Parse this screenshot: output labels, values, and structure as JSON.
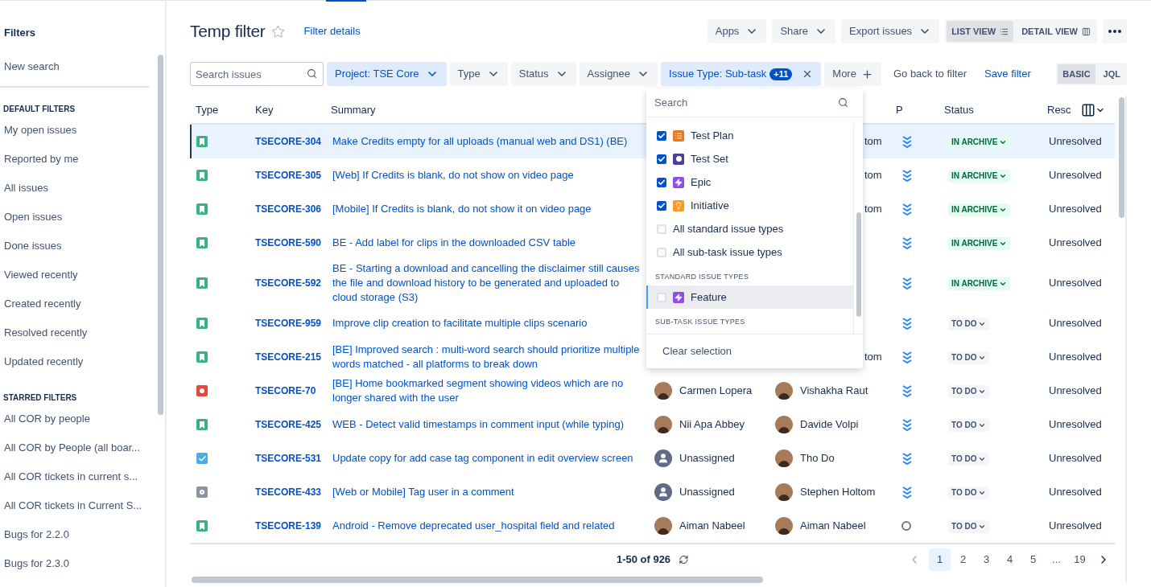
{
  "sidebar": {
    "title": "Filters",
    "top_items": [
      {
        "label": "New search"
      }
    ],
    "sections": [
      {
        "heading": "DEFAULT FILTERS",
        "items": [
          {
            "label": "My open issues"
          },
          {
            "label": "Reported by me"
          },
          {
            "label": "All issues"
          },
          {
            "label": "Open issues"
          },
          {
            "label": "Done issues"
          },
          {
            "label": "Viewed recently"
          },
          {
            "label": "Created recently"
          },
          {
            "label": "Resolved recently"
          },
          {
            "label": "Updated recently"
          }
        ]
      },
      {
        "heading": "STARRED FILTERS",
        "items": [
          {
            "label": "All COR by people"
          },
          {
            "label": "All COR by People (all boar..."
          },
          {
            "label": "All COR tickets in current s..."
          },
          {
            "label": "All COR tickets in Current S..."
          },
          {
            "label": "Bugs for 2.2.0"
          },
          {
            "label": "Bugs for 2.3.0"
          }
        ]
      }
    ]
  },
  "header": {
    "title": "Temp filter",
    "starred": false,
    "details_link": "Filter details",
    "actions": [
      "Apps",
      "Share",
      "Export issues"
    ],
    "views": [
      {
        "label": "LIST VIEW",
        "kind": "list",
        "selected": true
      },
      {
        "label": "DETAIL VIEW",
        "kind": "detail",
        "selected": false
      }
    ]
  },
  "filters": {
    "search_placeholder": "Search issues",
    "chips": [
      {
        "label": "Project: TSE Core",
        "kind": "dropdown",
        "active": true
      },
      {
        "label": "Type",
        "kind": "dropdown",
        "active": false
      },
      {
        "label": "Status",
        "kind": "dropdown",
        "active": false
      },
      {
        "label": "Assignee",
        "kind": "dropdown",
        "active": false
      },
      {
        "label": "Issue Type: Sub-task",
        "kind": "removable",
        "active": true,
        "badge": "+11"
      },
      {
        "label": "More",
        "kind": "add",
        "active": false
      }
    ],
    "links": [
      {
        "label": "Go back to filter",
        "kind": "plain"
      },
      {
        "label": "Save filter",
        "kind": "link"
      }
    ],
    "modes": [
      {
        "label": "BASIC",
        "selected": true
      },
      {
        "label": "JQL",
        "selected": false
      }
    ]
  },
  "table": {
    "columns": [
      "Type",
      "Key",
      "Summary",
      "P",
      "Status",
      "Resc"
    ],
    "rows": [
      {
        "kind": "story",
        "key": "TSECORE-304",
        "summary": "Make Credits empty for all uploads (manual web and DS1) (BE)",
        "reporter": "tom",
        "priority": {
          "kind": "lowest"
        },
        "status": {
          "label": "IN ARCHIVE",
          "kind": "done"
        },
        "resolution": "Unresolved",
        "selected": true
      },
      {
        "kind": "story",
        "key": "TSECORE-305",
        "summary": "[Web] If Credits is blank, do not show on video page",
        "reporter": "tom",
        "priority": {
          "kind": "lowest"
        },
        "status": {
          "label": "IN ARCHIVE",
          "kind": "done"
        },
        "resolution": "Unresolved",
        "selected": false
      },
      {
        "kind": "story",
        "key": "TSECORE-306",
        "summary": "[Mobile] If Credits is blank, do not show it on video page",
        "reporter": "tom",
        "priority": {
          "kind": "lowest"
        },
        "status": {
          "label": "IN ARCHIVE",
          "kind": "done"
        },
        "resolution": "Unresolved",
        "selected": false
      },
      {
        "kind": "story",
        "key": "TSECORE-590",
        "summary": "BE - Add label for clips in the downloaded CSV table",
        "priority": {
          "kind": "lowest"
        },
        "status": {
          "label": "IN ARCHIVE",
          "kind": "done"
        },
        "resolution": "Unresolved",
        "selected": false
      },
      {
        "kind": "story",
        "key": "TSECORE-592",
        "summary": "BE - Starting a download and cancelling the disclaimer still causes the file and download history to be generated and uploaded to cloud storage (S3)",
        "priority": {
          "kind": "lowest"
        },
        "status": {
          "label": "IN ARCHIVE",
          "kind": "done"
        },
        "resolution": "Unresolved",
        "selected": false
      },
      {
        "kind": "story",
        "key": "TSECORE-959",
        "summary": "Improve clip creation to facilitate multiple clips scenario",
        "priority": {
          "kind": "lowest"
        },
        "status": {
          "label": "TO DO",
          "kind": "todo"
        },
        "resolution": "Unresolved",
        "selected": false
      },
      {
        "kind": "story",
        "key": "TSECORE-215",
        "summary": "[BE] Improved search : multi-word search should prioritize multiple words matched - all platforms to break down",
        "reporter": "tom",
        "priority": {
          "kind": "lowest"
        },
        "status": {
          "label": "TO DO",
          "kind": "todo"
        },
        "resolution": "Unresolved",
        "selected": false
      },
      {
        "kind": "bug",
        "key": "TSECORE-70",
        "summary": "[BE] Home bookmarked segment showing videos which are no longer shared with the user",
        "assignee": {
          "name": "Carmen Lopera",
          "kind": "person"
        },
        "reporter": "Vishakha Raut",
        "priority": {
          "kind": "lowest"
        },
        "status": {
          "label": "TO DO",
          "kind": "todo"
        },
        "resolution": "Unresolved",
        "selected": false
      },
      {
        "kind": "story",
        "key": "TSECORE-425",
        "summary": "WEB - Detect valid timestamps in comment input (while typing)",
        "assignee": {
          "name": "Nii Apa Abbey",
          "kind": "person"
        },
        "reporter": "Davide Volpi",
        "priority": {
          "kind": "lowest"
        },
        "status": {
          "label": "TO DO",
          "kind": "todo"
        },
        "resolution": "Unresolved",
        "selected": false
      },
      {
        "kind": "task",
        "key": "TSECORE-531",
        "summary": "Update copy for add case tag component in edit overview screen",
        "assignee": {
          "name": "Unassigned",
          "kind": "unassigned"
        },
        "reporter": "Tho Do",
        "priority": {
          "kind": "lowest"
        },
        "status": {
          "label": "TO DO",
          "kind": "todo"
        },
        "resolution": "Unresolved",
        "selected": false
      },
      {
        "kind": "subtask",
        "key": "TSECORE-433",
        "summary": "[Web or Mobile] Tag user in a comment",
        "assignee": {
          "name": "Unassigned",
          "kind": "unassigned"
        },
        "reporter": "Stephen Holtom",
        "priority": {
          "kind": "lowest"
        },
        "status": {
          "label": "TO DO",
          "kind": "todo"
        },
        "resolution": "Unresolved",
        "selected": false
      },
      {
        "kind": "story",
        "key": "TSECORE-139",
        "summary": "Android - Remove deprecated user_hospital field and related",
        "assignee": {
          "name": "Aiman Nabeel",
          "kind": "person"
        },
        "reporter": "Aiman Nabeel",
        "priority": {
          "kind": "none"
        },
        "status": {
          "label": "TO DO",
          "kind": "todo"
        },
        "resolution": "Unresolved",
        "selected": false
      }
    ]
  },
  "dropdown": {
    "search_placeholder": "Search",
    "items": [
      {
        "kind": "option",
        "label": "Test Plan",
        "checked": true,
        "highlighted": false
      },
      {
        "kind": "option",
        "label": "Test Set",
        "checked": true,
        "highlighted": false
      },
      {
        "kind": "option",
        "label": "Epic",
        "checked": true,
        "highlighted": false
      },
      {
        "kind": "option",
        "label": "Initiative",
        "checked": true,
        "highlighted": false
      },
      {
        "kind": "option",
        "label": "All standard issue types",
        "checked": false,
        "highlighted": false
      },
      {
        "kind": "option",
        "label": "All sub-task issue types",
        "checked": false,
        "highlighted": false
      },
      {
        "kind": "heading",
        "label": "STANDARD ISSUE TYPES"
      },
      {
        "kind": "option",
        "label": "Feature",
        "checked": false,
        "highlighted": true
      },
      {
        "kind": "heading",
        "label": "SUB-TASK ISSUE TYPES"
      }
    ],
    "clear": "Clear selection"
  },
  "pagination": {
    "range": "1-50 of 926",
    "pages": [
      {
        "label": "1",
        "selected": true
      },
      {
        "label": "2",
        "selected": false
      },
      {
        "label": "3",
        "selected": false
      },
      {
        "label": "4",
        "selected": false
      },
      {
        "label": "5",
        "selected": false
      },
      {
        "label": "...",
        "selected": false
      },
      {
        "label": "19",
        "selected": false
      }
    ]
  }
}
